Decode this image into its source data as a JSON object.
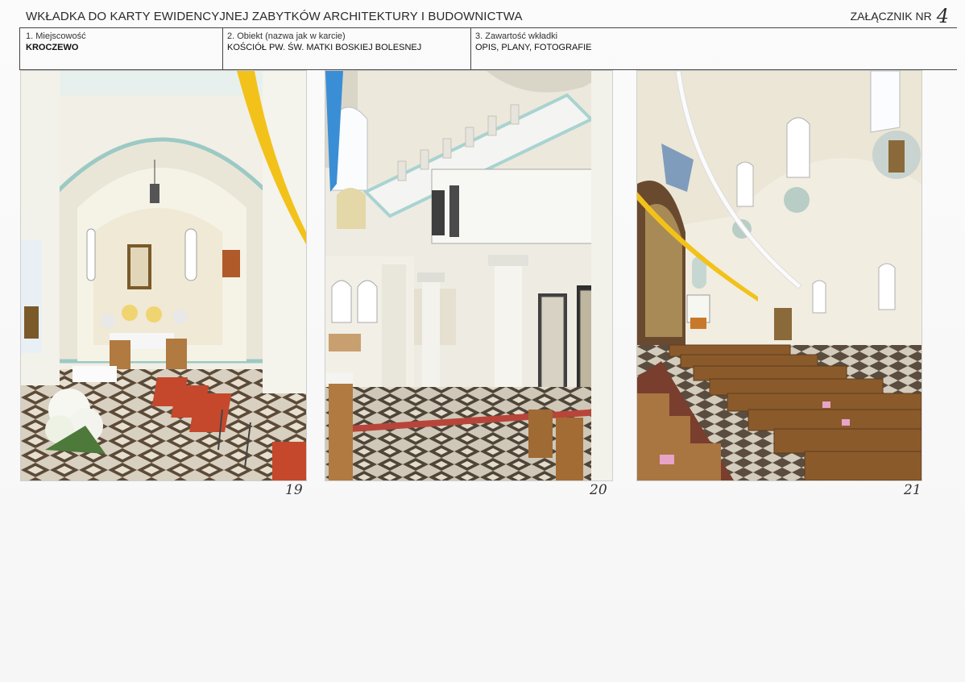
{
  "header": {
    "title": "WKŁADKA DO KARTY EWIDENCYJNEJ ZABYTKÓW ARCHITEKTURY I BUDOWNICTWA",
    "annex_label": "ZAŁĄCZNIK NR",
    "annex_number": "4"
  },
  "fields": [
    {
      "label": "1. Miejscowość",
      "value": "KROCZEWO"
    },
    {
      "label": "2. Obiekt (nazwa jak w karcie)",
      "value": "KOŚCIÓŁ PW. ŚW. MATKI BOSKIEJ BOLESNEJ"
    },
    {
      "label": "3. Zawartość wkładki",
      "value": "OPIS, PLANY, FOTOGRAFIE"
    }
  ],
  "photos": [
    {
      "number": "19"
    },
    {
      "number": "20"
    },
    {
      "number": "21"
    }
  ],
  "colors": {
    "wall": "#f3f0e6",
    "arch_trim": "#9cc9c4",
    "floor_dark": "#5a4a3a",
    "floor_light": "#d9d2c3",
    "wood": "#b07a40",
    "chair": "#c5482c",
    "ribbon_yellow": "#f2c21a",
    "ribbon_blue": "#3a8ed6"
  }
}
